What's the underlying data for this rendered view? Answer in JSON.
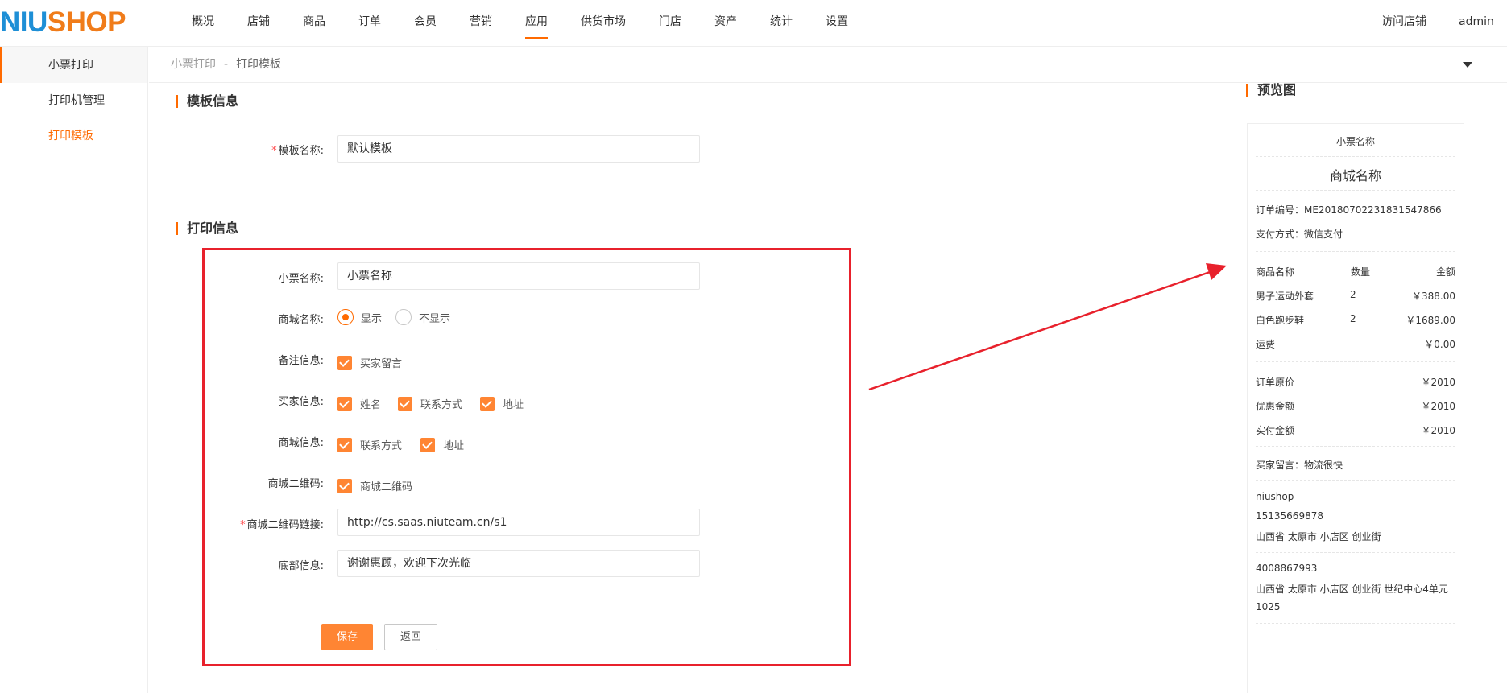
{
  "logo": {
    "part1": "NIU",
    "part2": "SHOP"
  },
  "nav": [
    "概况",
    "店铺",
    "商品",
    "订单",
    "会员",
    "营销",
    "应用",
    "供货市场",
    "门店",
    "资产",
    "统计",
    "设置"
  ],
  "nav_active": "应用",
  "header": {
    "visit_store": "访问店铺",
    "user": "admin"
  },
  "sidebar": {
    "group": "小票打印",
    "items": [
      "打印机管理",
      "打印模板"
    ]
  },
  "breadcrumb": {
    "first": "小票打印",
    "separator": "-",
    "current": "打印模板"
  },
  "template_section": {
    "title": "模板信息",
    "name_label": "模板名称:",
    "name_value": "默认模板"
  },
  "print_section": {
    "title": "打印信息",
    "ticket_name_label": "小票名称:",
    "ticket_name_value": "小票名称",
    "store_name_label": "商城名称:",
    "store_name_options": {
      "show": "显示",
      "hide": "不显示"
    },
    "store_name_selected": "显示",
    "remark_label": "备注信息:",
    "remark_options": [
      "买家留言"
    ],
    "buyer_label": "买家信息:",
    "buyer_options": [
      "姓名",
      "联系方式",
      "地址"
    ],
    "store_info_label": "商城信息:",
    "store_info_options": [
      "联系方式",
      "地址"
    ],
    "qrcode_label": "商城二维码:",
    "qrcode_options": [
      "商城二维码"
    ],
    "qrcode_link_label": "商城二维码链接:",
    "qrcode_link_value": "http://cs.saas.niuteam.cn/s1",
    "footer_label": "底部信息:",
    "footer_value": "谢谢惠顾，欢迎下次光临",
    "save_label": "保存",
    "back_label": "返回"
  },
  "preview": {
    "title": "预览图",
    "ticket_name": "小票名称",
    "store_name": "商城名称",
    "order_no": "订单编号：ME20180702231831547866",
    "pay_method": "支付方式：微信支付",
    "table_headers": [
      "商品名称",
      "数量",
      "金额"
    ],
    "items": [
      {
        "name": "男子运动外套",
        "qty": "2",
        "amount": "￥388.00"
      },
      {
        "name": "白色跑步鞋",
        "qty": "2",
        "amount": "￥1689.00"
      },
      {
        "name": "运费",
        "qty": "",
        "amount": "￥0.00"
      }
    ],
    "totals": [
      {
        "label": "订单原价",
        "value": "￥2010"
      },
      {
        "label": "优惠金额",
        "value": "￥2010"
      },
      {
        "label": "实付金额",
        "value": "￥2010"
      }
    ],
    "buyer_note": "买家留言：物流很快",
    "buyer_name": "niushop",
    "buyer_phone": "15135669878",
    "buyer_address": "山西省 太原市 小店区 创业街",
    "store_phone": "4008867993",
    "store_address_1": "山西省 太原市 小店区 创业街 世纪中心4单元",
    "store_address_2": "1025"
  },
  "colors": {
    "accent": "#ff6a00",
    "checkbox": "#ff8533",
    "annotation": "#e8212c",
    "logo_blue": "#1e8fd6",
    "logo_orange": "#f07c1a"
  }
}
